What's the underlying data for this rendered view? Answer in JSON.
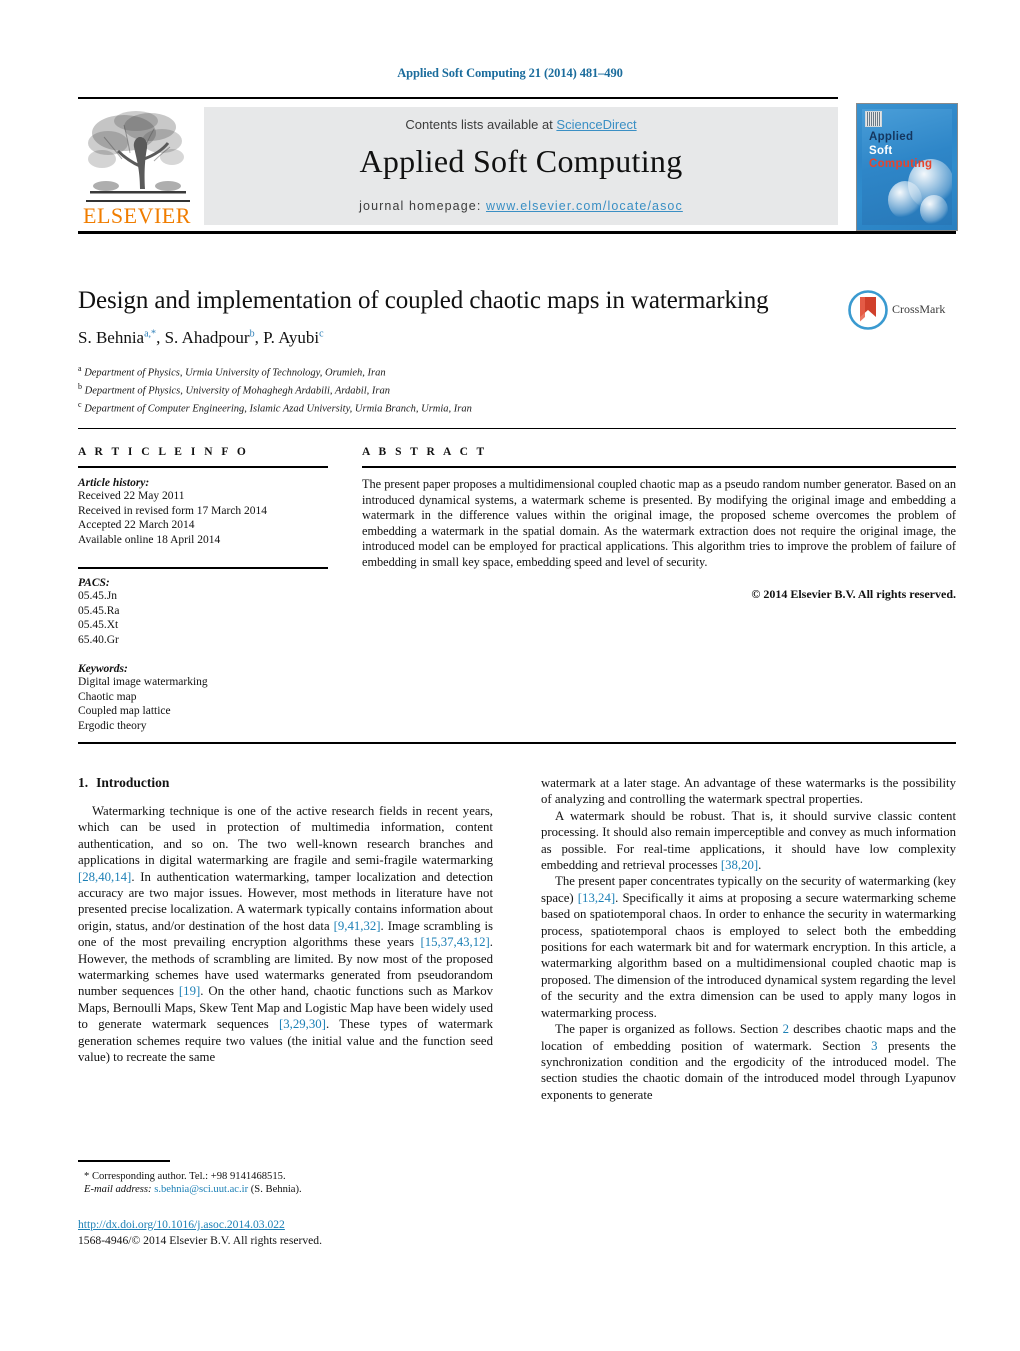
{
  "running_head": "Applied Soft Computing 21 (2014) 481–490",
  "masthead": {
    "contents_prefix": "Contents lists available at ",
    "contents_link": "ScienceDirect",
    "journal_name": "Applied Soft Computing",
    "homepage_label": "journal homepage:",
    "homepage_url": "www.elsevier.com/locate/asoc",
    "publisher_logo_text": "ELSEVIER",
    "cover": {
      "line1": "Applied",
      "line2": "Soft",
      "line3": "Computing"
    },
    "accent_link_color": "#3a8fc4"
  },
  "crossmark": {
    "label": "CrossMark"
  },
  "title": "Design and implementation of coupled chaotic maps in watermarking",
  "authors_html": "S. Behnia<sup>a,*</sup>, S. Ahadpour<sup>b</sup>, P. Ayubi<sup>c</sup>",
  "authors_plain": "S. Behnia a,*, S. Ahadpour b, P. Ayubi c",
  "affiliations": [
    {
      "marker": "a",
      "text": "Department of Physics, Urmia University of Technology, Orumieh, Iran"
    },
    {
      "marker": "b",
      "text": "Department of Physics, University of Mohaghegh Ardabili, Ardabil, Iran"
    },
    {
      "marker": "c",
      "text": "Department of Computer Engineering, Islamic Azad University, Urmia Branch, Urmia, Iran"
    }
  ],
  "article_info": {
    "heading": "A R T I C L E    I N F O",
    "history_label": "Article history:",
    "history": [
      "Received 22 May 2011",
      "Received in revised form 17 March 2014",
      "Accepted 22 March 2014",
      "Available online 18 April 2014"
    ],
    "pacs_label": "PACS:",
    "pacs": [
      "05.45.Jn",
      "05.45.Ra",
      "05.45.Xt",
      "65.40.Gr"
    ],
    "keywords_label": "Keywords:",
    "keywords": [
      "Digital image watermarking",
      "Chaotic map",
      "Coupled map lattice",
      "Ergodic theory"
    ]
  },
  "abstract": {
    "heading": "A B S T R A C T",
    "text": "The present paper proposes a multidimensional coupled chaotic map as a pseudo random number generator. Based on an introduced dynamical systems, a watermark scheme is presented. By modifying the original image and embedding a watermark in the difference values within the original image, the proposed scheme overcomes the problem of embedding a watermark in the spatial domain. As the watermark extraction does not require the original image, the introduced model can be employed for practical applications. This algorithm tries to improve the problem of failure of embedding in small key space, embedding speed and level of security.",
    "copyright": "© 2014 Elsevier B.V. All rights reserved."
  },
  "body": {
    "section1_number": "1.",
    "section1_title": "Introduction",
    "left_paragraph_1": "Watermarking technique is one of the active research fields in recent years, which can be used in protection of multimedia information, content authentication, and so on. The two well-known research branches and applications in digital watermarking are fragile and semi-fragile watermarking [28,40,14]. In authentication watermarking, tamper localization and detection accuracy are two major issues. However, most methods in literature have not presented precise localization. A watermark typically contains information about origin, status, and/or destination of the host data [9,41,32]. Image scrambling is one of the most prevailing encryption algorithms these years [15,37,43,12]. However, the methods of scrambling are limited. By now most of the proposed watermarking schemes have used watermarks generated from pseudorandom number sequences [19]. On the other hand, chaotic functions such as Markov Maps, Bernoulli Maps, Skew Tent Map and Logistic Map have been widely used to generate watermark sequences [3,29,30]. These types of watermark generation schemes require two values (the initial value and the function seed value) to recreate the same",
    "right_paragraph_1": "watermark at a later stage. An advantage of these watermarks is the possibility of analyzing and controlling the watermark spectral properties.",
    "right_paragraph_2": "A watermark should be robust. That is, it should survive classic content processing. It should also remain imperceptible and convey as much information as possible. For real-time applications, it should have low complexity embedding and retrieval processes [38,20].",
    "right_paragraph_3": "The present paper concentrates typically on the security of watermarking (key space) [13,24]. Specifically it aims at proposing a secure watermarking scheme based on spatiotemporal chaos. In order to enhance the security in watermarking process, spatiotemporal chaos is employed to select both the embedding positions for each watermark bit and for watermark encryption. In this article, a watermarking algorithm based on a multidimensional coupled chaotic map is proposed. The dimension of the introduced dynamical system regarding the level of the security and the extra dimension can be used to apply many logos in watermarking process.",
    "right_paragraph_4": "The paper is organized as follows. Section 2 describes chaotic maps and the location of embedding position of watermark. Section 3 presents the synchronization condition and the ergodicity of the introduced model. The section studies the chaotic domain of the introduced model through Lyapunov exponents to generate"
  },
  "footnote": {
    "corresponding": "* Corresponding author. Tel.: +98 9141468515.",
    "email_label": "E-mail address:",
    "email": "s.behnia@sci.uut.ac.ir",
    "email_owner": "(S. Behnia)."
  },
  "footer": {
    "doi": "http://dx.doi.org/10.1016/j.asoc.2014.03.022",
    "issn_line": "1568-4946/© 2014 Elsevier B.V. All rights reserved."
  }
}
